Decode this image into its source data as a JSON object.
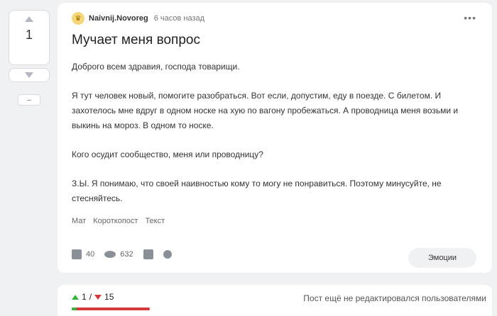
{
  "vote": {
    "count": "1",
    "hide_label": "–"
  },
  "post": {
    "avatar_icon": "crown-avatar-icon",
    "author": "Naivnij.Novoreg",
    "time": "6 часов назад",
    "title": "Мучает меня вопрос",
    "paragraphs": [
      "Доброго всем здравия, господа товарищи.",
      "Я тут человек новый, помогите разобраться. Вот если, допустим, еду в поезде. С билетом. И захотелось мне вдруг в одном носке на хую по вагону пробежаться. А проводница меня возьми и выкинь на мороз. В одном то носке.",
      "Кого осудит сообщество, меня или проводницу?",
      "З.Ы. Я понимаю, что своей наивностью кому то могу не понравиться. Поэтому минусуйте, не стесняйтесь."
    ],
    "tags": [
      "Мат",
      "Короткопост",
      "Текст"
    ],
    "comments": "40",
    "views": "632",
    "emotions_label": "Эмоции"
  },
  "stats": {
    "pluses": "1",
    "minuses": "15",
    "slash": "/",
    "plus_share": 0.0625,
    "note": "Пост ещё не редактировался пользователями"
  }
}
